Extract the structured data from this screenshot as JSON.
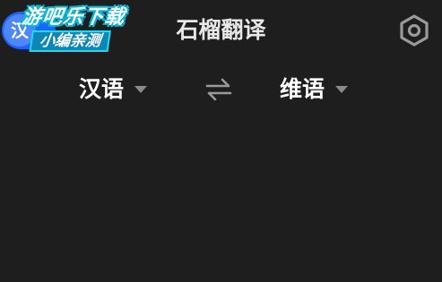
{
  "header": {
    "mode_toggle_label": "汉",
    "title": "石榴翻译",
    "settings_icon": "gear-icon"
  },
  "watermark": {
    "line1": "游吧乐下载",
    "line2": "小编亲测"
  },
  "language_bar": {
    "source_language": "汉语",
    "target_language": "维语",
    "swap_icon": "swap-arrows-icon"
  },
  "colors": {
    "background": "#1e1e1e",
    "toggle_blue": "#1f63ff",
    "text": "#ffffff",
    "icon_gray": "#9a9a9a"
  }
}
